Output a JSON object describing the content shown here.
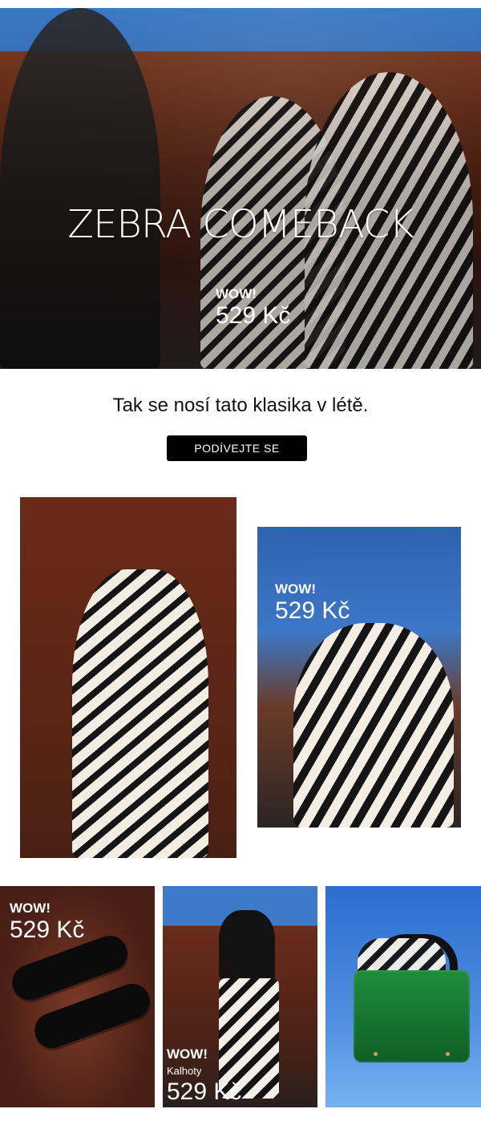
{
  "hero": {
    "title": "ZEBRA COMEBACK",
    "wow": "WOW!",
    "price": "529 Kč"
  },
  "intro": {
    "tagline": "Tak se nosí tato klasika v létě.",
    "cta_label": "PODÍVEJTE SE"
  },
  "products": {
    "blouse": {
      "wow": "WOW!",
      "price": "529 Kč"
    },
    "sandals": {
      "wow": "WOW!",
      "price": "529 Kč"
    },
    "pants": {
      "wow": "WOW!",
      "subtitle": "Kalhoty",
      "price": "529 Kč"
    }
  },
  "colors": {
    "cta_bg": "#000000",
    "cta_text": "#ffffff",
    "overlay_text": "#ffffff"
  }
}
